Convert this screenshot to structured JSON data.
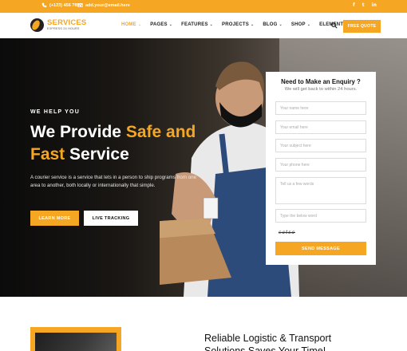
{
  "topbar": {
    "phone": "(+123) 456 7890",
    "email": "add.your@email.here",
    "social": [
      "f",
      "t",
      "in"
    ],
    "color": "#f5a623"
  },
  "nav": {
    "logo_title": "SERVICES",
    "logo_sub": "EXPRESS 24 HOURS",
    "items": [
      {
        "label": "HOME",
        "active": true
      },
      {
        "label": "PAGES",
        "active": false
      },
      {
        "label": "FEATURES",
        "active": false
      },
      {
        "label": "PROJECTS",
        "active": false
      },
      {
        "label": "BLOG",
        "active": false
      },
      {
        "label": "SHOP",
        "active": false
      },
      {
        "label": "ELEMENTS",
        "active": false
      }
    ],
    "search_icon": "search-icon",
    "quote_label": "FREE QUOTE"
  },
  "hero": {
    "eyebrow": "WE HELP YOU",
    "title_1": "We Provide ",
    "title_hl_1": "Safe and",
    "title_hl_2": "Fast",
    "title_2": " Service",
    "text": "A courier service is a service that lets in a person to ship programs from one area to another, both locally or internationally that simple.",
    "learn_label": "LEARN MORE",
    "track_label": "LIVE TRACKING"
  },
  "form": {
    "title": "Need to Make an Enquiry ?",
    "subtitle": "We will get back to within 24 hours.",
    "name_placeholder": "Your name here",
    "email_placeholder": "Your email here",
    "subject_placeholder": "Your subject here",
    "phone_placeholder": "Your phone here",
    "message_placeholder": "Tell us a few words",
    "captcha_placeholder": "Type the below word",
    "captcha_text": "catsa",
    "send_label": "SEND MESSAGE"
  },
  "lower": {
    "title": "Reliable Logistic & Transport Solutions Saves Your Time!"
  },
  "colors": {
    "accent": "#f5a623",
    "dark": "#111111"
  }
}
